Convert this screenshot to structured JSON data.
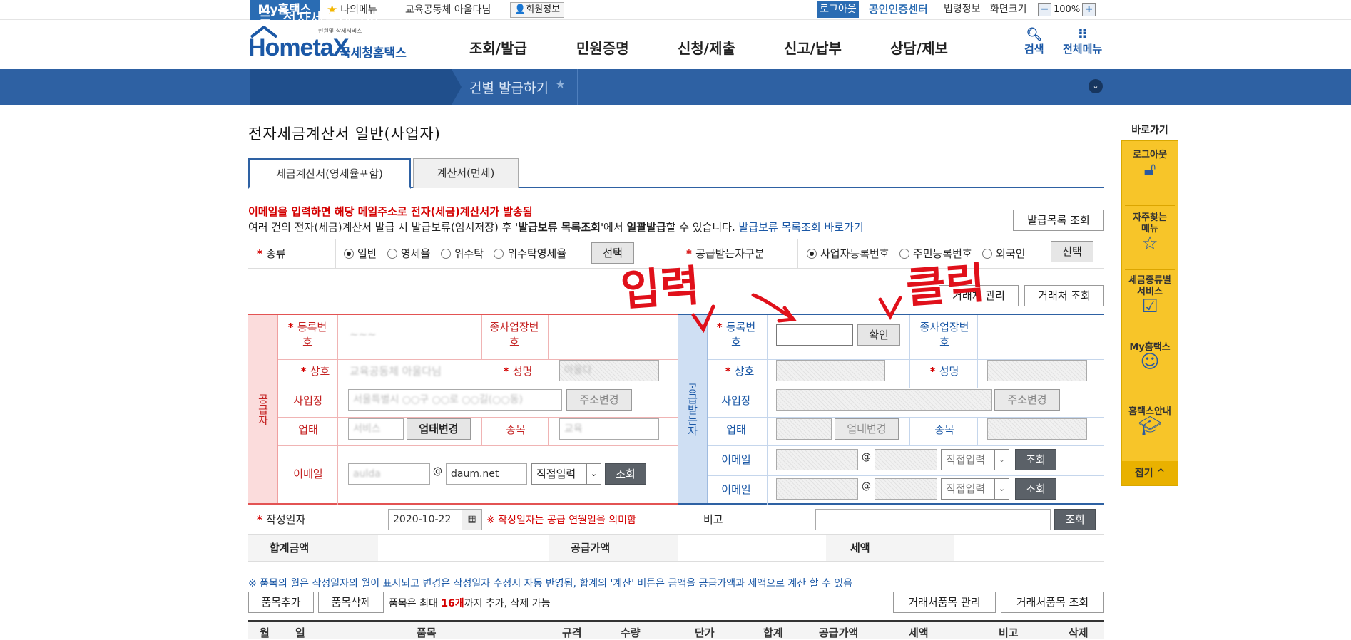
{
  "topbar": {
    "brand": "My홈택스",
    "my_menu": "나의메뉴",
    "user_name": "교육공동체 아울다님",
    "member_info": "회원정보",
    "logout": "로그아웃",
    "cert_center": "공인인증센터",
    "law_info": "법령정보",
    "screen_size": "화면크기",
    "zoom_minus": "−",
    "zoom": "100%",
    "zoom_plus": "+"
  },
  "header": {
    "logo_text": "HometaX",
    "logo_sub": "국세청홈택스",
    "logo_small": "민원및 상세서비스",
    "nav": [
      "조회/발급",
      "민원증명",
      "신청/제출",
      "신고/납부",
      "상담/제보"
    ],
    "search": "검색",
    "all_menu": "전체메뉴"
  },
  "breadcrumb": {
    "menu": "전자세금계산서",
    "sub": "건별 발급하기"
  },
  "page": {
    "title": "전자세금계산서 일반(사업자)",
    "tabs": [
      "세금계산서(영세율포함)",
      "계산서(면세)"
    ],
    "notice_red": "이메일을 입력하면 해당 메일주소로 전자(세금)계산서가 발송됨",
    "notice_1": "여러 건의 전자(세금)계산서 발급 시 발급보류(임시저장) 후 '",
    "notice_b1": "발급보류 목록조회",
    "notice_2": "'에서 ",
    "notice_b2": "일괄발급",
    "notice_3": "할 수 있습니다. ",
    "notice_link": "발급보류 목록조회 바로가기",
    "issue_list_btn": "발급목록 조회"
  },
  "type_row": {
    "label": "종류",
    "options": [
      "일반",
      "영세율",
      "위수탁",
      "위수탁영세율"
    ],
    "select_btn": "선택",
    "recv_label": "공급받는자구분",
    "recv_options": [
      "사업자등록번호",
      "주민등록번호",
      "외국인"
    ],
    "recv_select_btn": "선택",
    "partner_mgmt": "거래처 관리",
    "partner_query": "거래처 조회"
  },
  "supplier": {
    "side": "공급자",
    "reg_no_label": "등록번호",
    "reg_no": "~~~",
    "branch_label": "종사업장번호",
    "name_label": "상호",
    "name_value": "교육공동체 아울다님",
    "ceo_label": "성명",
    "ceo_value": "아울다",
    "addr_label": "사업장",
    "addr_value": "서울특별시 ○○구 ○○로 ○○길(○○동)",
    "addr_btn": "주소변경",
    "biz_type_label": "업태",
    "biz_type_value": "서비스",
    "biz_type_btn": "업태변경",
    "item_label": "종목",
    "item_value": "교육",
    "email_label": "이메일",
    "email_id": "aulda",
    "email_at": "@",
    "email_domain": "daum.net",
    "email_select": "직접입력",
    "email_btn": "조회"
  },
  "receiver": {
    "side": "공급받는자",
    "reg_no_label": "등록번호",
    "reg_no_value": "",
    "confirm_btn": "확인",
    "branch_label": "종사업장번호",
    "name_label": "상호",
    "ceo_label": "성명",
    "addr_label": "사업장",
    "addr_btn": "주소변경",
    "biz_type_label": "업태",
    "biz_type_btn": "업태변경",
    "item_label": "종목",
    "email1_label": "이메일",
    "email2_label": "이메일",
    "email_at": "@",
    "email_select": "직접입력",
    "email_btn": "조회"
  },
  "annotations": {
    "input": "입력",
    "click": "클릭"
  },
  "date_row": {
    "label": "작성일자",
    "value": "2020-10-22",
    "note": "※ 작성일자는 공급 연월일을 의미함",
    "remark_label": "비고",
    "remark_btn": "조회"
  },
  "totals_row": {
    "total_label": "합계금액",
    "supply_label": "공급가액",
    "tax_label": "세액"
  },
  "items": {
    "note": "※ 품목의 월은 작성일자의 월이 표시되고 변경은 작성일자 수정시 자동 반영됨, 합계의 '계산' 버튼은 금액을 공급가액과 세액으로 계산 할 수 있음",
    "add_btn": "품목추가",
    "del_btn": "품목삭제",
    "limit_1": "품목은 최대 ",
    "limit_n": "16개",
    "limit_2": "까지 추가, 삭제 가능",
    "partner_item_mgmt": "거래처품목 관리",
    "partner_item_query": "거래처품목 조회",
    "columns": [
      "월",
      "일",
      "품목",
      "규격",
      "수량",
      "단가",
      "합계",
      "공급가액",
      "세액",
      "비고",
      "삭제"
    ]
  },
  "quicklinks": {
    "head": "바로가기",
    "items": [
      "로그아웃",
      "자주찾는 메뉴",
      "세금종류별 서비스",
      "My홈택스",
      "홈택스안내"
    ],
    "close": "접기 ^"
  }
}
